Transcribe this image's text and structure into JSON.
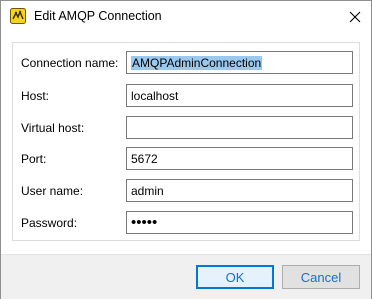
{
  "window": {
    "title": "Edit AMQP Connection",
    "icon": "amqp-connection-icon",
    "close_icon": "close-icon"
  },
  "form": {
    "fields": [
      {
        "label": "Connection name:",
        "value": "AMQPAdminConnection",
        "selected": true
      },
      {
        "label": "Host:",
        "value": "localhost"
      },
      {
        "label": "Virtual host:",
        "value": ""
      },
      {
        "label": "Port:",
        "value": "5672"
      },
      {
        "label": "User name:",
        "value": "admin"
      },
      {
        "label": "Password:",
        "value": "•••••",
        "masked": true
      }
    ]
  },
  "buttons": {
    "ok_label": "OK",
    "cancel_label": "Cancel"
  },
  "colors": {
    "accent": "#0078d7",
    "button_text": "#1a6ec8",
    "selection": "#99c9ef"
  }
}
